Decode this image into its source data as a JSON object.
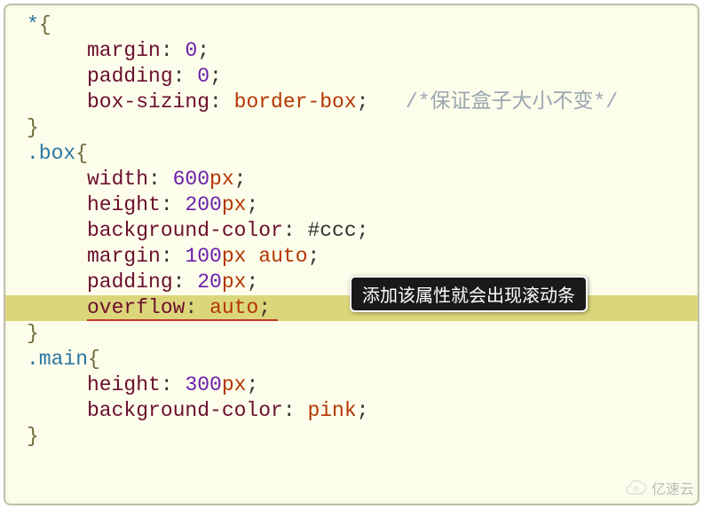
{
  "code": {
    "sel_star": "*",
    "brace_open": "{",
    "brace_close": "}",
    "margin": "margin",
    "padding": "padding",
    "box_sizing": "box-sizing",
    "border_box": "border-box",
    "comment_box": "/*保证盒子大小不变*/",
    "zero": "0",
    "box_sel": ".box",
    "width": "width",
    "height": "height",
    "bg_color": "background-color",
    "ccc": "#ccc",
    "val_600": "600",
    "val_200": "200",
    "val_100": "100",
    "val_20": "20",
    "val_300": "300",
    "px": "px",
    "auto": "auto",
    "overflow": "overflow",
    "main_sel": ".main",
    "pink": "pink"
  },
  "callout_text": "添加该属性就会出现滚动条",
  "watermark_text": "亿速云"
}
